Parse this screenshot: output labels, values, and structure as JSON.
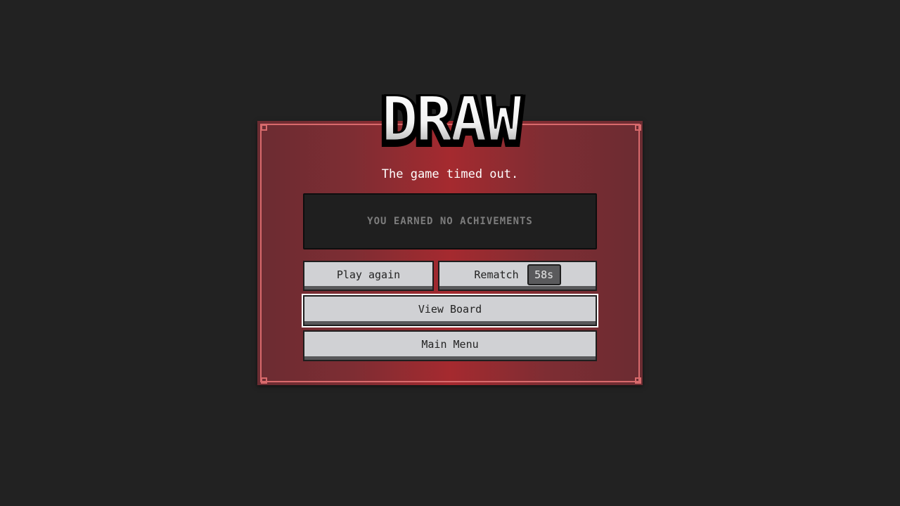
{
  "dialog": {
    "title": "DRAW",
    "subtitle": "The game timed out.",
    "achievements_text": "YOU EARNED NO ACHIVEMENTS"
  },
  "buttons": {
    "play_again": "Play again",
    "rematch": "Rematch",
    "rematch_timer": "58s",
    "view_board": "View Board",
    "main_menu": "Main Menu"
  },
  "colors": {
    "background": "#222222",
    "panel_red": "#a52a2f",
    "panel_border": "#d86a6c",
    "button_face": "#d0d1d4",
    "achievement_box": "#1f1f1f"
  },
  "state": {
    "focused_button": "View Board"
  }
}
